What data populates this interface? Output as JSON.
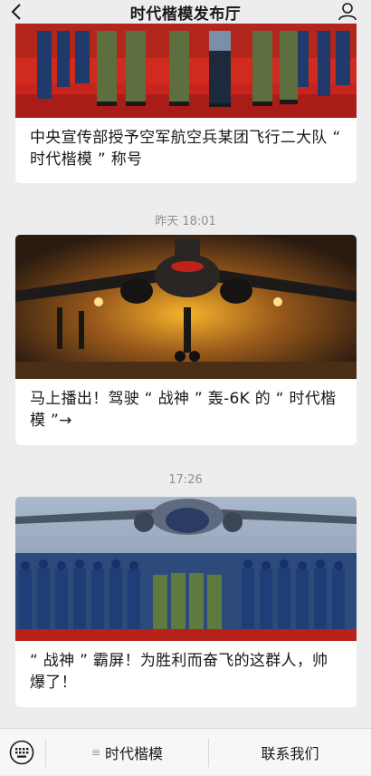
{
  "header": {
    "title": "时代楷模发布厅",
    "back_icon": "chevron-left-icon",
    "profile_icon": "user-icon"
  },
  "feed": {
    "cards": [
      {
        "headline": "中央宣传部授予空军航空兵某团飞行二大队 “ 时代楷模 ” 称号",
        "image": "honor-guard-ceremony-photo"
      },
      {
        "headline": "马上播出！驾驶 “ 战神 ” 轰-6K 的 “ 时代楷模 ”→",
        "image": "bomber-jet-front-photo"
      },
      {
        "headline": "“ 战神 ” 霸屏！为胜利而奋飞的这群人，帅爆了！",
        "image": "pilots-saluting-photo"
      }
    ],
    "timestamps": [
      "昨天 18:01",
      "17:26"
    ]
  },
  "bottom_bar": {
    "keyboard_icon": "keyboard-icon",
    "menu_icon": "menu-list-icon",
    "menu1_label": "时代楷模",
    "menu2_label": "联系我们"
  },
  "colors": {
    "background": "#ededed",
    "card": "#ffffff",
    "timestamp": "#8f8f8f",
    "carpet_red": "#c8231c"
  }
}
